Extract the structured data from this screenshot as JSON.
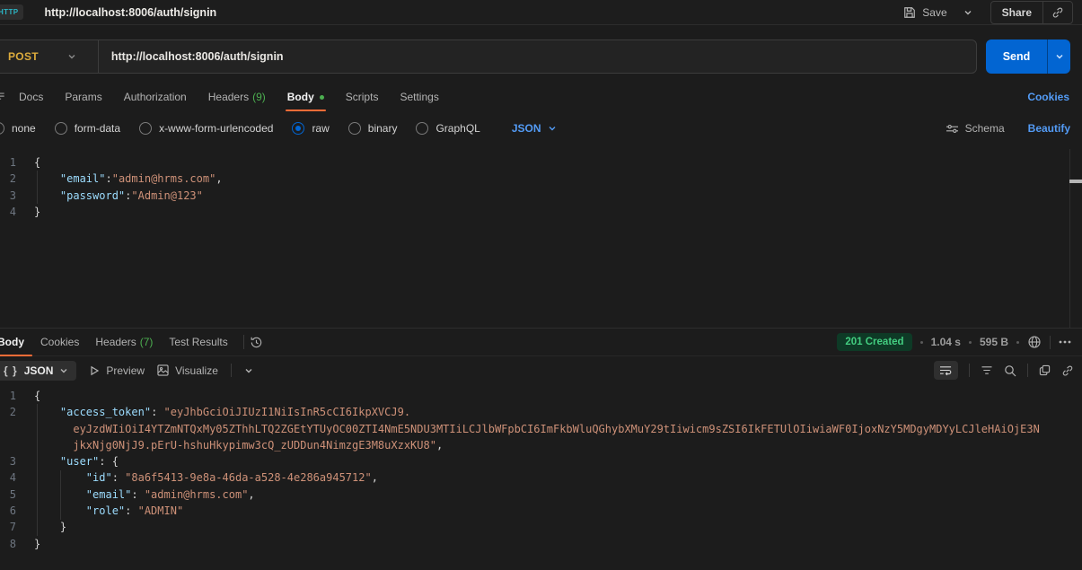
{
  "colors": {
    "accent_orange": "#ff6c37",
    "method_post_yellow": "#dcab3c",
    "send_blue": "#0265d2",
    "link_blue": "#539bf5",
    "count_green": "#4caf50",
    "status_green": "#43cd80",
    "code_key": "#9cdcfe",
    "code_string": "#ce9178"
  },
  "topbar": {
    "tab_type": "HTTP",
    "title": "http://localhost:8006/auth/signin",
    "save_label": "Save",
    "share_label": "Share"
  },
  "request": {
    "method": "POST",
    "url": "http://localhost:8006/auth/signin",
    "send_label": "Send",
    "tabs": [
      {
        "label": "Docs"
      },
      {
        "label": "Params"
      },
      {
        "label": "Authorization"
      },
      {
        "label": "Headers",
        "count": "(9)"
      },
      {
        "label": "Body"
      },
      {
        "label": "Scripts"
      },
      {
        "label": "Settings"
      }
    ],
    "cookies_link": "Cookies",
    "body_types": [
      {
        "label": "none"
      },
      {
        "label": "form-data"
      },
      {
        "label": "x-www-form-urlencoded"
      },
      {
        "label": "raw",
        "selected": true
      },
      {
        "label": "binary"
      },
      {
        "label": "GraphQL"
      }
    ],
    "format": "JSON",
    "schema_label": "Schema",
    "beautify_label": "Beautify"
  },
  "request_editor": {
    "lines": [
      {
        "num": "1",
        "segs": [
          [
            "p",
            "{"
          ]
        ]
      },
      {
        "num": "2",
        "segs": [
          [
            "p",
            "    "
          ],
          [
            "k",
            "\"email\""
          ],
          [
            "p",
            ":"
          ],
          [
            "s",
            "\"admin@hrms.com\""
          ],
          [
            "p",
            ","
          ]
        ]
      },
      {
        "num": "3",
        "segs": [
          [
            "p",
            "    "
          ],
          [
            "k",
            "\"password\""
          ],
          [
            "p",
            ":"
          ],
          [
            "s",
            "\"Admin@123\""
          ]
        ]
      },
      {
        "num": "4",
        "segs": [
          [
            "p",
            "}"
          ]
        ]
      }
    ]
  },
  "response": {
    "tabs": [
      {
        "label": "Body",
        "active": true
      },
      {
        "label": "Cookies"
      },
      {
        "label": "Headers",
        "count": "(7)"
      },
      {
        "label": "Test Results"
      }
    ],
    "status": "201 Created",
    "time": "1.04 s",
    "size": "595 B",
    "format": "JSON",
    "braces_glyph": "{ }",
    "preview_label": "Preview",
    "visualize_label": "Visualize"
  },
  "response_editor": {
    "lines": [
      {
        "num": "1",
        "segs": [
          [
            "p",
            "{"
          ]
        ]
      },
      {
        "num": "2",
        "segs": [
          [
            "p",
            "    "
          ],
          [
            "k",
            "\"access_token\""
          ],
          [
            "p",
            ": "
          ],
          [
            "s",
            "\"eyJhbGciOiJIUzI1NiIsInR5cCI6IkpXVCJ9."
          ]
        ]
      },
      {
        "num": "",
        "segs": [
          [
            "p",
            "      "
          ],
          [
            "s",
            "eyJzdWIiOiI4YTZmNTQxMy05ZThhLTQ2ZGEtYTUyOC00ZTI4NmE5NDU3MTIiLCJlbWFpbCI6ImFkbWluQGhybXMuY29tIiwicm9sZSI6IkFETUlOIiwiaWF0IjoxNzY5MDgyMDYyLCJleHAiOjE3N"
          ]
        ]
      },
      {
        "num": "",
        "segs": [
          [
            "p",
            "      "
          ],
          [
            "s",
            "jkxNjg0NjJ9.pErU-hshuHkypimw3cQ_zUDDun4NimzgE3M8uXzxKU8\""
          ],
          [
            "p",
            ","
          ]
        ]
      },
      {
        "num": "3",
        "segs": [
          [
            "p",
            "    "
          ],
          [
            "k",
            "\"user\""
          ],
          [
            "p",
            ": {"
          ]
        ]
      },
      {
        "num": "4",
        "segs": [
          [
            "p",
            "        "
          ],
          [
            "k",
            "\"id\""
          ],
          [
            "p",
            ": "
          ],
          [
            "s",
            "\"8a6f5413-9e8a-46da-a528-4e286a945712\""
          ],
          [
            "p",
            ","
          ]
        ]
      },
      {
        "num": "5",
        "segs": [
          [
            "p",
            "        "
          ],
          [
            "k",
            "\"email\""
          ],
          [
            "p",
            ": "
          ],
          [
            "s",
            "\"admin@hrms.com\""
          ],
          [
            "p",
            ","
          ]
        ]
      },
      {
        "num": "6",
        "segs": [
          [
            "p",
            "        "
          ],
          [
            "k",
            "\"role\""
          ],
          [
            "p",
            ": "
          ],
          [
            "s",
            "\"ADMIN\""
          ]
        ]
      },
      {
        "num": "7",
        "segs": [
          [
            "p",
            "    }"
          ]
        ]
      },
      {
        "num": "8",
        "segs": [
          [
            "p",
            "}"
          ]
        ]
      }
    ],
    "full_access_token": "eyJhbGciOiJIUzI1NiIsInR5cCI6IkpXVCJ9.eyJzdWIiOiI4YTZmNTQxMy05ZThhLTQ2ZGEtYTUyOC00ZTI4NmE5NDU3MTIiLCJlbWFpbCI6ImFkbWluQGhybXMuY29tIiwicm9sZSI6IkFETUlOIiwiaWF0IjoxNzY5MDgyMDYyLCJleHAiOjE3NjkxNjg0NjJ9.pErU-hshuHkypimw3cQ_zUDDun4NimzgE3M8uXzxKU8",
    "user": {
      "id": "8a6f5413-9e8a-46da-a528-4e286a945712",
      "email": "admin@hrms.com",
      "role": "ADMIN"
    }
  }
}
